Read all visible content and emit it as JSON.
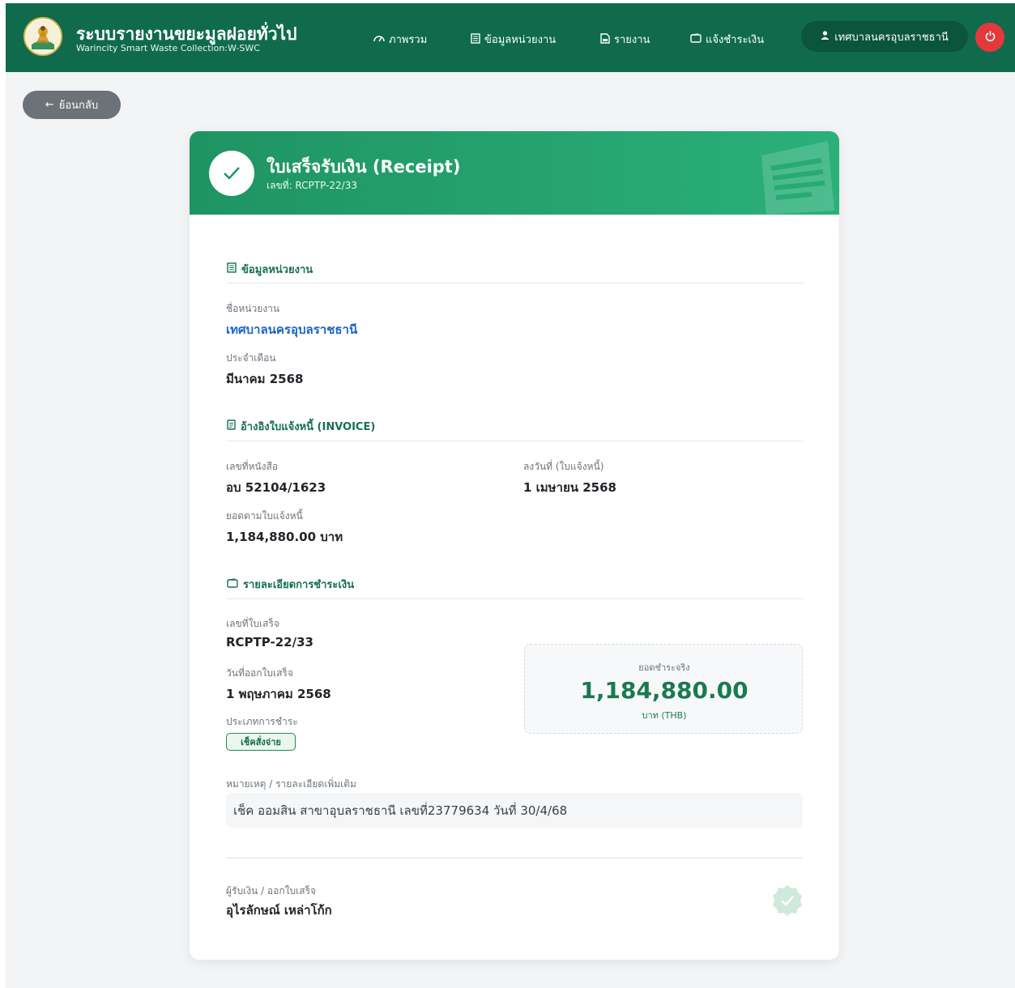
{
  "app": {
    "title": "ระบบรายงานขยะมูลฝอยทั่วไป",
    "subtitle": "Warincity Smart Waste Collection:W-SWC"
  },
  "nav": {
    "items": [
      {
        "label": "ภาพรวม",
        "icon": "gauge-icon"
      },
      {
        "label": "ข้อมูลหน่วยงาน",
        "icon": "building-icon"
      },
      {
        "label": "รายงาน",
        "icon": "report-icon"
      },
      {
        "label": "แจ้งชำระเงิน",
        "icon": "wallet-icon"
      }
    ],
    "user": "เทศบาลนครอุบลราชธานี"
  },
  "back_label": "ย้อนกลับ",
  "receipt": {
    "title": "ใบเสร็จรับเงิน (Receipt)",
    "number_line": "เลขที่: RCPTP-22/33"
  },
  "org_section": {
    "title": "ข้อมูลหน่วยงาน",
    "name_label": "ชื่อหน่วยงาน",
    "name_value": "เทศบาลนครอุบลราชธานี",
    "month_label": "ประจำเดือน",
    "month_value": "มีนาคม 2568"
  },
  "invoice_section": {
    "title": "อ้างอิงใบแจ้งหนี้ (INVOICE)",
    "doc_no_label": "เลขที่หนังสือ",
    "doc_no_value": "อบ 52104/1623",
    "date_label": "ลงวันที่ (ใบแจ้งหนี้)",
    "date_value": "1 เมษายน 2568",
    "amount_label": "ยอดตามใบแจ้งหนี้",
    "amount_value": "1,184,880.00 บาท"
  },
  "payment_section": {
    "title": "รายละเอียดการชำระเงิน",
    "receipt_no_label": "เลขที่ใบเสร็จ",
    "receipt_no_value": "RCPTP-22/33",
    "issue_date_label": "วันที่ออกใบเสร็จ",
    "issue_date_value": "1 พฤษภาคม 2568",
    "pay_type_label": "ประเภทการชำระ",
    "pay_type_value": "เช็คสั่งจ่าย",
    "actual_label": "ยอดชำระจริง",
    "actual_value": "1,184,880.00",
    "actual_currency": "บาท (THB)",
    "note_label": "หมายเหตุ / รายละเอียดเพิ่มเติม",
    "note_value": "เช็ค ออมสิน สาขาอุบลราชธานี เลขที่23779634 วันที่ 30/4/68"
  },
  "signature": {
    "label": "ผู้รับเงิน / ออกใบเสร็จ",
    "name": "อุไรลักษณ์ เหล่าโก้ก"
  },
  "colors": {
    "header": "#0f6b4c",
    "accent": "#1e9462",
    "amount": "#1a7a4f",
    "link": "#1a64c8",
    "logout": "#e4393a"
  }
}
